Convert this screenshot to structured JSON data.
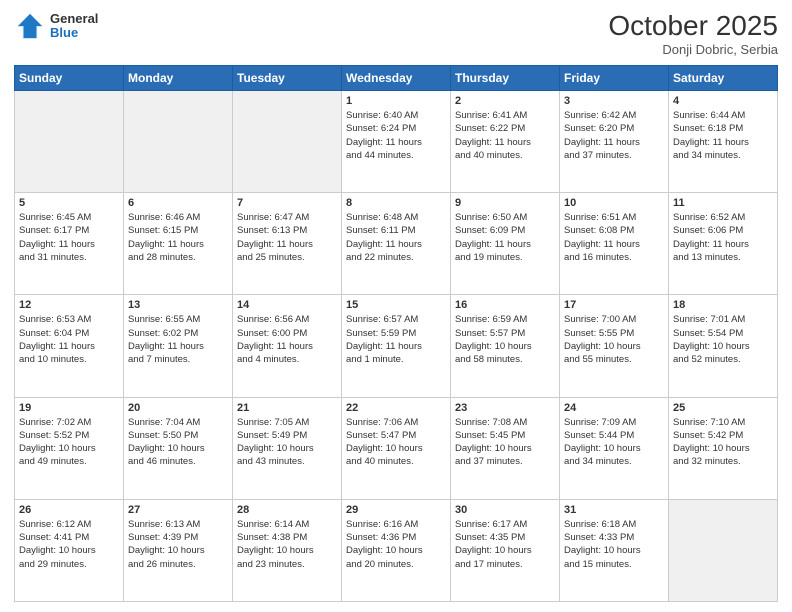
{
  "header": {
    "logo_general": "General",
    "logo_blue": "Blue",
    "month_title": "October 2025",
    "location": "Donji Dobric, Serbia"
  },
  "days_of_week": [
    "Sunday",
    "Monday",
    "Tuesday",
    "Wednesday",
    "Thursday",
    "Friday",
    "Saturday"
  ],
  "weeks": [
    [
      {
        "day": "",
        "info": "",
        "empty": true
      },
      {
        "day": "",
        "info": "",
        "empty": true
      },
      {
        "day": "",
        "info": "",
        "empty": true
      },
      {
        "day": "1",
        "info": "Sunrise: 6:40 AM\nSunset: 6:24 PM\nDaylight: 11 hours\nand 44 minutes.",
        "empty": false
      },
      {
        "day": "2",
        "info": "Sunrise: 6:41 AM\nSunset: 6:22 PM\nDaylight: 11 hours\nand 40 minutes.",
        "empty": false
      },
      {
        "day": "3",
        "info": "Sunrise: 6:42 AM\nSunset: 6:20 PM\nDaylight: 11 hours\nand 37 minutes.",
        "empty": false
      },
      {
        "day": "4",
        "info": "Sunrise: 6:44 AM\nSunset: 6:18 PM\nDaylight: 11 hours\nand 34 minutes.",
        "empty": false
      }
    ],
    [
      {
        "day": "5",
        "info": "Sunrise: 6:45 AM\nSunset: 6:17 PM\nDaylight: 11 hours\nand 31 minutes.",
        "empty": false
      },
      {
        "day": "6",
        "info": "Sunrise: 6:46 AM\nSunset: 6:15 PM\nDaylight: 11 hours\nand 28 minutes.",
        "empty": false
      },
      {
        "day": "7",
        "info": "Sunrise: 6:47 AM\nSunset: 6:13 PM\nDaylight: 11 hours\nand 25 minutes.",
        "empty": false
      },
      {
        "day": "8",
        "info": "Sunrise: 6:48 AM\nSunset: 6:11 PM\nDaylight: 11 hours\nand 22 minutes.",
        "empty": false
      },
      {
        "day": "9",
        "info": "Sunrise: 6:50 AM\nSunset: 6:09 PM\nDaylight: 11 hours\nand 19 minutes.",
        "empty": false
      },
      {
        "day": "10",
        "info": "Sunrise: 6:51 AM\nSunset: 6:08 PM\nDaylight: 11 hours\nand 16 minutes.",
        "empty": false
      },
      {
        "day": "11",
        "info": "Sunrise: 6:52 AM\nSunset: 6:06 PM\nDaylight: 11 hours\nand 13 minutes.",
        "empty": false
      }
    ],
    [
      {
        "day": "12",
        "info": "Sunrise: 6:53 AM\nSunset: 6:04 PM\nDaylight: 11 hours\nand 10 minutes.",
        "empty": false
      },
      {
        "day": "13",
        "info": "Sunrise: 6:55 AM\nSunset: 6:02 PM\nDaylight: 11 hours\nand 7 minutes.",
        "empty": false
      },
      {
        "day": "14",
        "info": "Sunrise: 6:56 AM\nSunset: 6:00 PM\nDaylight: 11 hours\nand 4 minutes.",
        "empty": false
      },
      {
        "day": "15",
        "info": "Sunrise: 6:57 AM\nSunset: 5:59 PM\nDaylight: 11 hours\nand 1 minute.",
        "empty": false
      },
      {
        "day": "16",
        "info": "Sunrise: 6:59 AM\nSunset: 5:57 PM\nDaylight: 10 hours\nand 58 minutes.",
        "empty": false
      },
      {
        "day": "17",
        "info": "Sunrise: 7:00 AM\nSunset: 5:55 PM\nDaylight: 10 hours\nand 55 minutes.",
        "empty": false
      },
      {
        "day": "18",
        "info": "Sunrise: 7:01 AM\nSunset: 5:54 PM\nDaylight: 10 hours\nand 52 minutes.",
        "empty": false
      }
    ],
    [
      {
        "day": "19",
        "info": "Sunrise: 7:02 AM\nSunset: 5:52 PM\nDaylight: 10 hours\nand 49 minutes.",
        "empty": false
      },
      {
        "day": "20",
        "info": "Sunrise: 7:04 AM\nSunset: 5:50 PM\nDaylight: 10 hours\nand 46 minutes.",
        "empty": false
      },
      {
        "day": "21",
        "info": "Sunrise: 7:05 AM\nSunset: 5:49 PM\nDaylight: 10 hours\nand 43 minutes.",
        "empty": false
      },
      {
        "day": "22",
        "info": "Sunrise: 7:06 AM\nSunset: 5:47 PM\nDaylight: 10 hours\nand 40 minutes.",
        "empty": false
      },
      {
        "day": "23",
        "info": "Sunrise: 7:08 AM\nSunset: 5:45 PM\nDaylight: 10 hours\nand 37 minutes.",
        "empty": false
      },
      {
        "day": "24",
        "info": "Sunrise: 7:09 AM\nSunset: 5:44 PM\nDaylight: 10 hours\nand 34 minutes.",
        "empty": false
      },
      {
        "day": "25",
        "info": "Sunrise: 7:10 AM\nSunset: 5:42 PM\nDaylight: 10 hours\nand 32 minutes.",
        "empty": false
      }
    ],
    [
      {
        "day": "26",
        "info": "Sunrise: 6:12 AM\nSunset: 4:41 PM\nDaylight: 10 hours\nand 29 minutes.",
        "empty": false
      },
      {
        "day": "27",
        "info": "Sunrise: 6:13 AM\nSunset: 4:39 PM\nDaylight: 10 hours\nand 26 minutes.",
        "empty": false
      },
      {
        "day": "28",
        "info": "Sunrise: 6:14 AM\nSunset: 4:38 PM\nDaylight: 10 hours\nand 23 minutes.",
        "empty": false
      },
      {
        "day": "29",
        "info": "Sunrise: 6:16 AM\nSunset: 4:36 PM\nDaylight: 10 hours\nand 20 minutes.",
        "empty": false
      },
      {
        "day": "30",
        "info": "Sunrise: 6:17 AM\nSunset: 4:35 PM\nDaylight: 10 hours\nand 17 minutes.",
        "empty": false
      },
      {
        "day": "31",
        "info": "Sunrise: 6:18 AM\nSunset: 4:33 PM\nDaylight: 10 hours\nand 15 minutes.",
        "empty": false
      },
      {
        "day": "",
        "info": "",
        "empty": true
      }
    ]
  ]
}
